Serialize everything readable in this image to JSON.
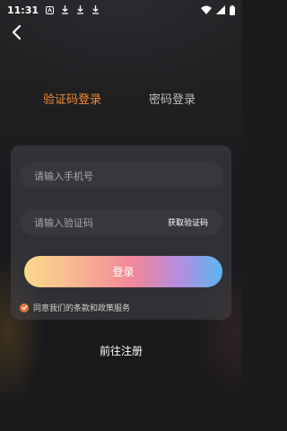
{
  "status_bar": {
    "time": "11:31",
    "icons": [
      "notification-icon",
      "download-icon",
      "download-icon",
      "download-icon"
    ],
    "right_icons": [
      "wifi-icon",
      "signal-icon",
      "battery-icon"
    ]
  },
  "tabs": {
    "sms_login": "验证码登录",
    "password_login": "密码登录"
  },
  "form": {
    "phone_placeholder": "请输入手机号",
    "code_placeholder": "请输入验证码",
    "get_code_label": "获取验证码"
  },
  "login_button": "登录",
  "agreement": {
    "checked": true,
    "label": "同意我们的条款和政策服务"
  },
  "register_link": "前往注册",
  "colors": {
    "accent": "#f08a34",
    "check": "#e8743b",
    "card": "#46464b",
    "field": "#38383c"
  }
}
